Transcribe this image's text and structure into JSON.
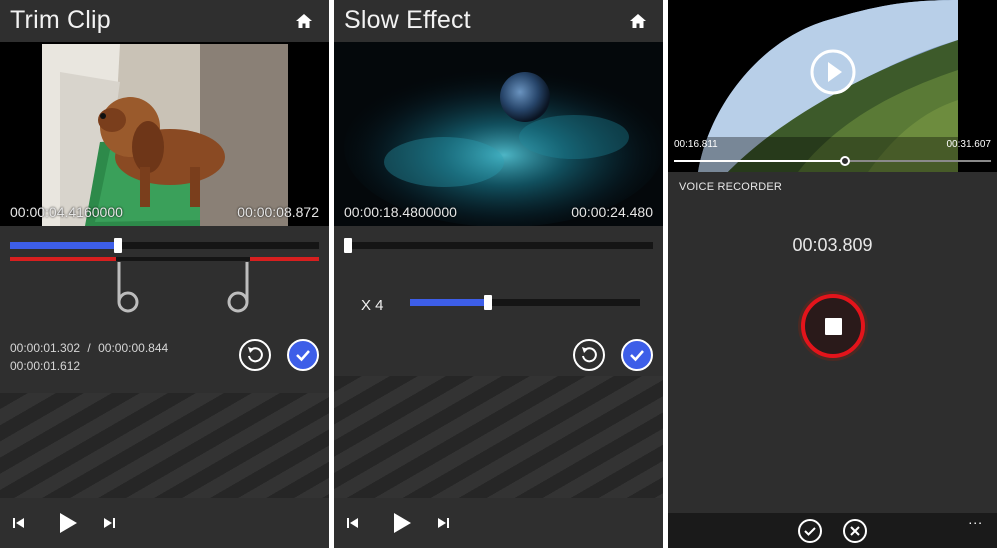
{
  "trim_clip": {
    "title": "Trim Clip",
    "video": {
      "time_left": "00:00:04.4160000",
      "time_right": "00:00:08.872"
    },
    "progress": 0.35,
    "time_line1": "00:00:01.302",
    "time_sep": "/",
    "time_line1b": "00:00:00.844",
    "time_line2": "00:00:01.612"
  },
  "slow_effect": {
    "title": "Slow Effect",
    "video": {
      "time_left": "00:00:18.4800000",
      "time_right": "00:00:24.480"
    },
    "speed_label": "X 4",
    "speed_fill": 0.34
  },
  "voice_recorder": {
    "time_left": "00:16.811",
    "time_right": "00:31.607",
    "progress": 0.54,
    "label": "VOICE RECORDER",
    "elapsed": "00:03.809",
    "more": "..."
  },
  "colors": {
    "accent": "#3d5ee8",
    "record": "#e3141b",
    "trim_marker": "#d71f1f"
  },
  "icons": [
    "home-icon",
    "undo-icon",
    "check-icon",
    "skip-back-icon",
    "play-icon",
    "skip-forward-icon",
    "stop-icon",
    "close-icon",
    "play-circle-icon"
  ]
}
